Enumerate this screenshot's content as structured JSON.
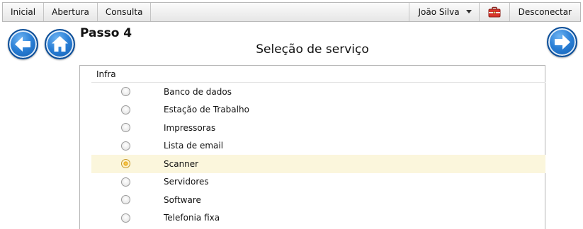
{
  "toolbar": {
    "menu": [
      {
        "label": "Inicial"
      },
      {
        "label": "Abertura"
      },
      {
        "label": "Consulta"
      }
    ],
    "user_name": "João Silva",
    "logout_label": "Desconectar",
    "icons": {
      "user_menu": "chevron-down-icon",
      "case": "toolbox-icon"
    }
  },
  "nav": {
    "back_icon": "arrow-left-icon",
    "home_icon": "home-icon",
    "next_icon": "arrow-right-icon"
  },
  "header": {
    "step": "Passo 4",
    "title": "Seleção de serviço"
  },
  "services": {
    "group": "Infra",
    "selected": "Scanner",
    "items": [
      {
        "label": "Banco de dados",
        "checked": false
      },
      {
        "label": "Estação de Trabalho",
        "checked": false
      },
      {
        "label": "Impressoras",
        "checked": false
      },
      {
        "label": "Lista de email",
        "checked": false
      },
      {
        "label": "Scanner",
        "checked": true
      },
      {
        "label": "Servidores",
        "checked": false
      },
      {
        "label": "Software",
        "checked": false
      },
      {
        "label": "Telefonia fixa",
        "checked": false
      }
    ]
  },
  "colors": {
    "accent_blue": "#1e6fc8",
    "selected_row": "#fbf6dc",
    "radio_checked": "#e9a919",
    "case_icon": "#d9342b"
  }
}
